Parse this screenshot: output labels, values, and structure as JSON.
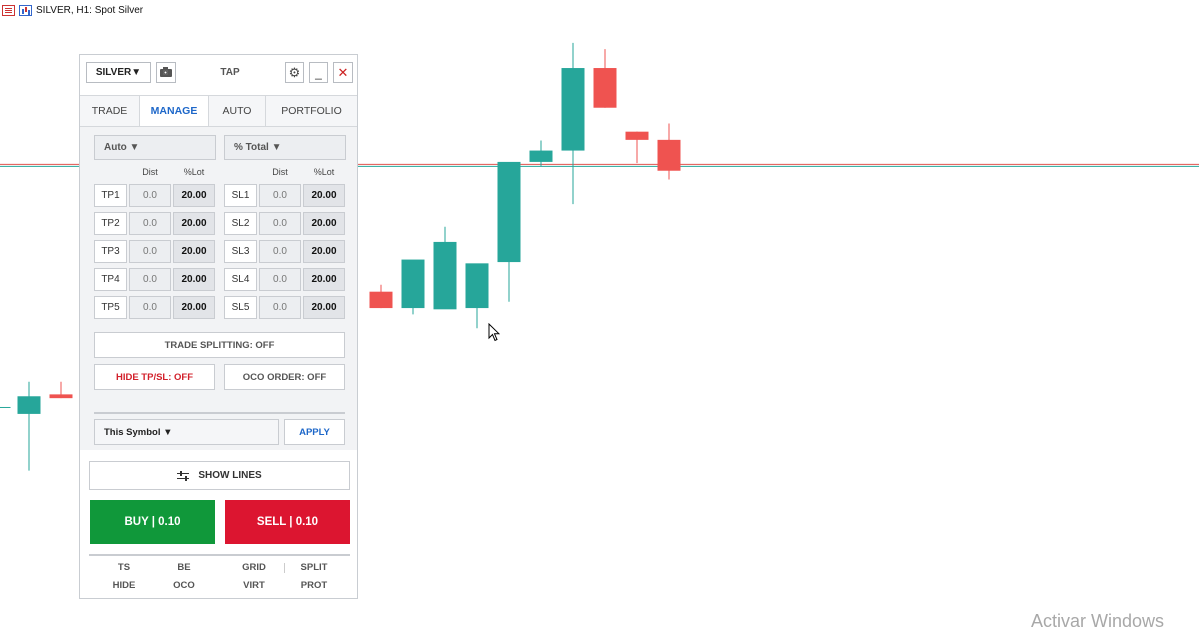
{
  "window": {
    "title": "SILVER, H1:  Spot Silver"
  },
  "watermark": "Activar Windows",
  "colors": {
    "bull": "#26a69a",
    "bear": "#ef5350",
    "buy": "#10983a",
    "sell": "#dc1530",
    "accent": "#1d67c9"
  },
  "icons": {
    "settings": "gear-icon",
    "minimize": "minimize-icon",
    "close": "close-icon",
    "screenshot": "camera-icon",
    "lines": "sliders-icon",
    "cursor": "mouse-cursor-icon"
  },
  "panel": {
    "symbol": "SILVER▼",
    "title": "TAP",
    "gear": "⚙",
    "minimize": "_",
    "close": "✕",
    "tabs": [
      "TRADE",
      "MANAGE",
      "AUTO",
      "PORTFOLIO"
    ],
    "active_tab": "MANAGE",
    "manage": {
      "left_mode": "Auto ▼",
      "right_mode": "% Total ▼",
      "col_dist": "Dist",
      "col_lot": "%Lot",
      "tp_rows": [
        {
          "label": "TP1",
          "dist": "0.0",
          "lot": "20.00"
        },
        {
          "label": "TP2",
          "dist": "0.0",
          "lot": "20.00"
        },
        {
          "label": "TP3",
          "dist": "0.0",
          "lot": "20.00"
        },
        {
          "label": "TP4",
          "dist": "0.0",
          "lot": "20.00"
        },
        {
          "label": "TP5",
          "dist": "0.0",
          "lot": "20.00"
        }
      ],
      "sl_rows": [
        {
          "label": "SL1",
          "dist": "0.0",
          "lot": "20.00"
        },
        {
          "label": "SL2",
          "dist": "0.0",
          "lot": "20.00"
        },
        {
          "label": "SL3",
          "dist": "0.0",
          "lot": "20.00"
        },
        {
          "label": "SL4",
          "dist": "0.0",
          "lot": "20.00"
        },
        {
          "label": "SL5",
          "dist": "0.0",
          "lot": "20.00"
        }
      ],
      "trade_splitting": "TRADE SPLITTING: OFF",
      "hide_tpsl": "HIDE TP/SL: OFF",
      "oco_order": "OCO ORDER: OFF",
      "scope": "This Symbol ▼",
      "apply": "APPLY"
    },
    "show_lines": "SHOW LINES",
    "buy": "BUY | 0.10",
    "sell": "SELL | 0.10",
    "footer": {
      "row1": [
        "TS",
        "BE",
        "GRID",
        "SPLIT"
      ],
      "row2": [
        "HIDE",
        "OCO",
        "VIRT",
        "PROT"
      ]
    }
  },
  "chart_data": {
    "type": "candlestick",
    "title": "SILVER, H1:  Spot Silver",
    "note": "price scale not visible; OHLC in relative price units",
    "candles": [
      {
        "o": 35.4,
        "h": 36.8,
        "l": 34.6,
        "c": 35.4
      },
      {
        "o": 34.3,
        "h": 39.4,
        "l": 25.3,
        "c": 37.1
      },
      {
        "o": 37.4,
        "h": 39.4,
        "l": 36.8,
        "c": 36.8
      },
      {
        "o": 53.7,
        "h": 54.8,
        "l": 51.1,
        "c": 51.1
      },
      {
        "o": 51.1,
        "h": 57.9,
        "l": 50.1,
        "c": 58.8
      },
      {
        "o": 50.9,
        "h": 64.0,
        "l": 52.1,
        "c": 61.6
      },
      {
        "o": 51.1,
        "h": 57.8,
        "l": 47.9,
        "c": 58.2
      },
      {
        "o": 58.4,
        "h": 71.1,
        "l": 52.1,
        "c": 74.3
      },
      {
        "o": 74.3,
        "h": 77.7,
        "l": 73.6,
        "c": 76.1
      },
      {
        "o": 76.1,
        "h": 93.2,
        "l": 67.6,
        "c": 89.2
      },
      {
        "o": 89.2,
        "h": 92.2,
        "l": 82.9,
        "c": 82.9
      },
      {
        "o": 79.1,
        "h": 79.1,
        "l": 74.1,
        "c": 77.8
      },
      {
        "o": 77.8,
        "h": 80.4,
        "l": 71.5,
        "c": 72.9
      },
      {
        "o": 72.9,
        "h": 76.7,
        "l": 73.3,
        "c": 73.8
      }
    ],
    "hlines": [
      {
        "price": 73.9,
        "color": "#e0524e"
      },
      {
        "price": 73.6,
        "color": "#26a69a"
      }
    ]
  }
}
